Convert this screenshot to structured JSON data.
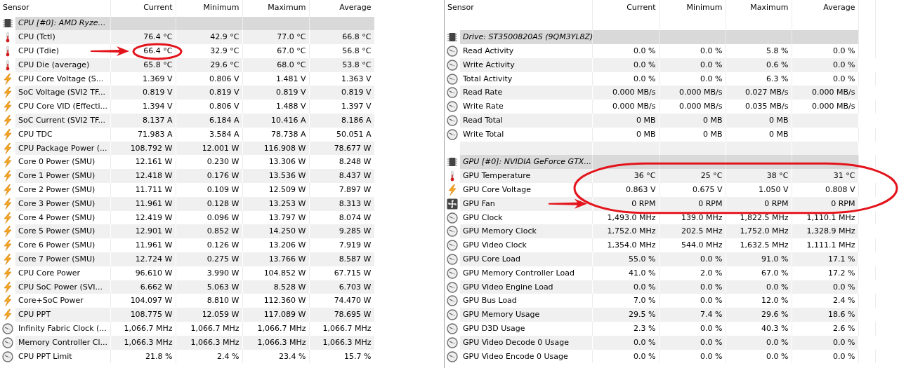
{
  "panels": [
    {
      "columns": [
        "Sensor",
        "Current",
        "Minimum",
        "Maximum",
        "Average"
      ],
      "section_gap": false,
      "extra_column": false,
      "sections": [
        {
          "title": "CPU [#0]: AMD Ryze…",
          "kind": "chip",
          "rows": [
            {
              "kind": "temperature",
              "name": "CPU (Tctl)",
              "values": [
                "76.4 °C",
                "42.9 °C",
                "77.0 °C",
                "66.8 °C"
              ],
              "arrow": false,
              "circle": false
            },
            {
              "kind": "temperature",
              "name": "CPU (Tdie)",
              "values": [
                "66.4 °C",
                "32.9 °C",
                "67.0 °C",
                "56.8 °C"
              ],
              "arrow": true,
              "circle": true
            },
            {
              "kind": "temperature",
              "name": "CPU Die (average)",
              "values": [
                "65.8 °C",
                "29.6 °C",
                "68.0 °C",
                "53.8 °C"
              ],
              "arrow": false,
              "circle": false
            },
            {
              "kind": "power",
              "name": "CPU Core Voltage (S...",
              "values": [
                "1.369 V",
                "0.806 V",
                "1.481 V",
                "1.363 V"
              ],
              "arrow": false,
              "circle": false
            },
            {
              "kind": "power",
              "name": "SoC Voltage (SVI2 TF...",
              "values": [
                "0.819 V",
                "0.819 V",
                "0.819 V",
                "0.819 V"
              ],
              "arrow": false,
              "circle": false
            },
            {
              "kind": "power",
              "name": "CPU Core VID (Effecti...",
              "values": [
                "1.394 V",
                "0.806 V",
                "1.488 V",
                "1.397 V"
              ],
              "arrow": false,
              "circle": false
            },
            {
              "kind": "power",
              "name": "SoC Current (SVI2 TF...",
              "values": [
                "8.137 A",
                "6.184 A",
                "10.416 A",
                "8.186 A"
              ],
              "arrow": false,
              "circle": false
            },
            {
              "kind": "power",
              "name": "CPU TDC",
              "values": [
                "71.983 A",
                "3.584 A",
                "78.738 A",
                "50.051 A"
              ],
              "arrow": false,
              "circle": false
            },
            {
              "kind": "power",
              "name": "CPU Package Power (...",
              "values": [
                "108.792 W",
                "12.001 W",
                "116.908 W",
                "78.677 W"
              ],
              "arrow": false,
              "circle": false
            },
            {
              "kind": "power",
              "name": "Core 0 Power (SMU)",
              "values": [
                "12.161 W",
                "0.230 W",
                "13.306 W",
                "8.248 W"
              ],
              "arrow": false,
              "circle": false
            },
            {
              "kind": "power",
              "name": "Core 1 Power (SMU)",
              "values": [
                "12.418 W",
                "0.176 W",
                "13.536 W",
                "8.437 W"
              ],
              "arrow": false,
              "circle": false
            },
            {
              "kind": "power",
              "name": "Core 2 Power (SMU)",
              "values": [
                "11.711 W",
                "0.109 W",
                "12.509 W",
                "7.897 W"
              ],
              "arrow": false,
              "circle": false
            },
            {
              "kind": "power",
              "name": "Core 3 Power (SMU)",
              "values": [
                "11.961 W",
                "0.128 W",
                "13.253 W",
                "8.313 W"
              ],
              "arrow": false,
              "circle": false
            },
            {
              "kind": "power",
              "name": "Core 4 Power (SMU)",
              "values": [
                "12.419 W",
                "0.096 W",
                "13.797 W",
                "8.074 W"
              ],
              "arrow": false,
              "circle": false
            },
            {
              "kind": "power",
              "name": "Core 5 Power (SMU)",
              "values": [
                "12.901 W",
                "0.852 W",
                "14.250 W",
                "9.285 W"
              ],
              "arrow": false,
              "circle": false
            },
            {
              "kind": "power",
              "name": "Core 6 Power (SMU)",
              "values": [
                "11.961 W",
                "0.126 W",
                "13.206 W",
                "7.919 W"
              ],
              "arrow": false,
              "circle": false
            },
            {
              "kind": "power",
              "name": "Core 7 Power (SMU)",
              "values": [
                "12.724 W",
                "0.275 W",
                "13.766 W",
                "8.587 W"
              ],
              "arrow": false,
              "circle": false
            },
            {
              "kind": "power",
              "name": "CPU Core Power",
              "values": [
                "96.610 W",
                "3.990 W",
                "104.852 W",
                "67.715 W"
              ],
              "arrow": false,
              "circle": false
            },
            {
              "kind": "power",
              "name": "CPU SoC Power (SVI...",
              "values": [
                "6.662 W",
                "5.063 W",
                "8.528 W",
                "6.703 W"
              ],
              "arrow": false,
              "circle": false
            },
            {
              "kind": "power",
              "name": "Core+SoC Power",
              "values": [
                "104.097 W",
                "8.810 W",
                "112.360 W",
                "74.470 W"
              ],
              "arrow": false,
              "circle": false
            },
            {
              "kind": "power",
              "name": "CPU PPT",
              "values": [
                "108.775 W",
                "12.059 W",
                "117.089 W",
                "78.695 W"
              ],
              "arrow": false,
              "circle": false
            },
            {
              "kind": "gauge",
              "name": "Infinity Fabric Clock (...",
              "values": [
                "1,066.7 MHz",
                "1,066.7 MHz",
                "1,066.7 MHz",
                "1,066.7 MHz"
              ],
              "arrow": false,
              "circle": false
            },
            {
              "kind": "gauge",
              "name": "Memory Controller Cl...",
              "values": [
                "1,066.3 MHz",
                "1,066.3 MHz",
                "1,066.3 MHz",
                "1,066.3 MHz"
              ],
              "arrow": false,
              "circle": false
            },
            {
              "kind": "gauge",
              "name": "CPU PPT Limit",
              "values": [
                "21.8 %",
                "2.4 %",
                "23.4 %",
                "15.7 %"
              ],
              "arrow": false,
              "circle": false
            }
          ]
        }
      ]
    },
    {
      "columns": [
        "Sensor",
        "Current",
        "Minimum",
        "Maximum",
        "Average"
      ],
      "section_gap": true,
      "extra_column": true,
      "sections": [
        {
          "title": "Drive: ST3500820AS (9QM3YL8Z)",
          "kind": "chip",
          "rows": [
            {
              "kind": "gauge",
              "name": "Read Activity",
              "values": [
                "0.0 %",
                "0.0 %",
                "5.8 %",
                "0.0 %"
              ],
              "arrow": false,
              "circle": false
            },
            {
              "kind": "gauge",
              "name": "Write Activity",
              "values": [
                "0.0 %",
                "0.0 %",
                "0.6 %",
                "0.0 %"
              ],
              "arrow": false,
              "circle": false
            },
            {
              "kind": "gauge",
              "name": "Total Activity",
              "values": [
                "0.0 %",
                "0.0 %",
                "6.3 %",
                "0.0 %"
              ],
              "arrow": false,
              "circle": false
            },
            {
              "kind": "gauge",
              "name": "Read Rate",
              "values": [
                "0.000 MB/s",
                "0.000 MB/s",
                "0.027 MB/s",
                "0.000 MB/s"
              ],
              "arrow": false,
              "circle": false
            },
            {
              "kind": "gauge",
              "name": "Write Rate",
              "values": [
                "0.000 MB/s",
                "0.000 MB/s",
                "0.035 MB/s",
                "0.000 MB/s"
              ],
              "arrow": false,
              "circle": false
            },
            {
              "kind": "gauge",
              "name": "Read Total",
              "values": [
                "0 MB",
                "0 MB",
                "0 MB"
              ],
              "arrow": false,
              "circle": false
            },
            {
              "kind": "gauge",
              "name": "Write Total",
              "values": [
                "0 MB",
                "0 MB",
                "0 MB"
              ],
              "arrow": false,
              "circle": false
            }
          ]
        },
        {
          "title": "GPU [#0]: NVIDIA GeForce GTX...",
          "kind": "chip",
          "rows": [
            {
              "kind": "temperature",
              "name": "GPU Temperature",
              "values": [
                "36 °C",
                "25 °C",
                "38 °C",
                "31 °C"
              ],
              "arrow": false,
              "circle": true
            },
            {
              "kind": "power",
              "name": "GPU Core Voltage",
              "values": [
                "0.863 V",
                "0.675 V",
                "1.050 V",
                "0.808 V"
              ],
              "arrow": false,
              "circle": true
            },
            {
              "kind": "fan",
              "name": "GPU Fan",
              "values": [
                "0 RPM",
                "0 RPM",
                "0 RPM",
                "0 RPM"
              ],
              "arrow": true,
              "circle": true
            },
            {
              "kind": "gauge",
              "name": "GPU Clock",
              "values": [
                "1,493.0 MHz",
                "139.0 MHz",
                "1,822.5 MHz",
                "1,110.1 MHz"
              ],
              "arrow": false,
              "circle": false
            },
            {
              "kind": "gauge",
              "name": "GPU Memory Clock",
              "values": [
                "1,752.0 MHz",
                "202.5 MHz",
                "1,752.0 MHz",
                "1,328.9 MHz"
              ],
              "arrow": false,
              "circle": false
            },
            {
              "kind": "gauge",
              "name": "GPU Video Clock",
              "values": [
                "1,354.0 MHz",
                "544.0 MHz",
                "1,632.5 MHz",
                "1,111.1 MHz"
              ],
              "arrow": false,
              "circle": false
            },
            {
              "kind": "gauge",
              "name": "GPU Core Load",
              "values": [
                "55.0 %",
                "0.0 %",
                "91.0 %",
                "17.1 %"
              ],
              "arrow": false,
              "circle": false
            },
            {
              "kind": "gauge",
              "name": "GPU Memory Controller Load",
              "values": [
                "41.0 %",
                "2.0 %",
                "67.0 %",
                "17.2 %"
              ],
              "arrow": false,
              "circle": false
            },
            {
              "kind": "gauge",
              "name": "GPU Video Engine Load",
              "values": [
                "0.0 %",
                "0.0 %",
                "0.0 %",
                "0.0 %"
              ],
              "arrow": false,
              "circle": false
            },
            {
              "kind": "gauge",
              "name": "GPU Bus Load",
              "values": [
                "7.0 %",
                "0.0 %",
                "12.0 %",
                "2.4 %"
              ],
              "arrow": false,
              "circle": false
            },
            {
              "kind": "gauge",
              "name": "GPU Memory Usage",
              "values": [
                "29.5 %",
                "7.4 %",
                "29.6 %",
                "18.6 %"
              ],
              "arrow": false,
              "circle": false
            },
            {
              "kind": "gauge",
              "name": "GPU D3D Usage",
              "values": [
                "2.3 %",
                "0.0 %",
                "40.3 %",
                "2.6 %"
              ],
              "arrow": false,
              "circle": false
            },
            {
              "kind": "gauge",
              "name": "GPU Video Decode 0 Usage",
              "values": [
                "0.0 %",
                "0.0 %",
                "0.0 %",
                "0.0 %"
              ],
              "arrow": false,
              "circle": false
            },
            {
              "kind": "gauge",
              "name": "GPU Video Encode 0 Usage",
              "values": [
                "0.0 %",
                "0.0 %",
                "0.0 %",
                "0.0 %"
              ],
              "arrow": false,
              "circle": false
            }
          ]
        }
      ]
    }
  ]
}
